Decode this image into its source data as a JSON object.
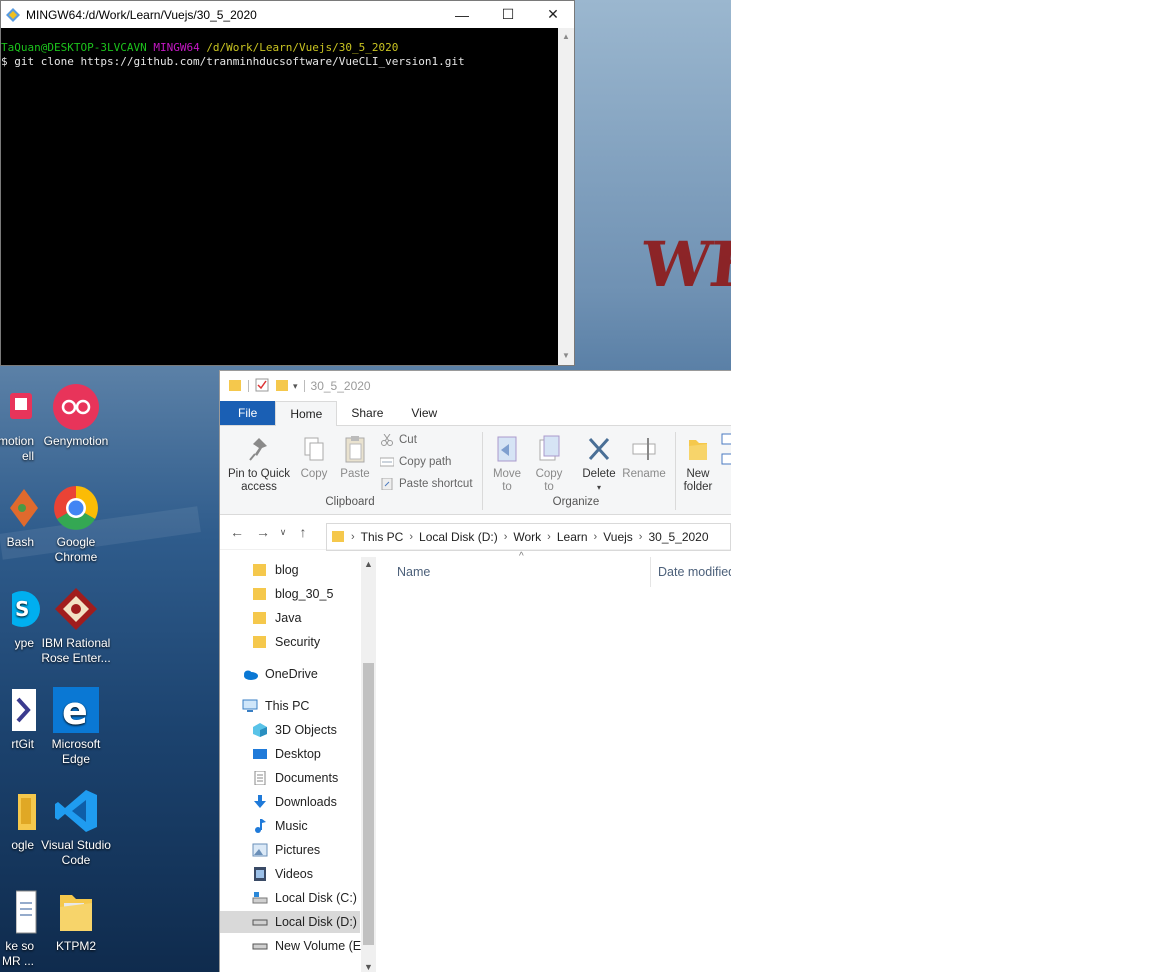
{
  "terminal": {
    "title": "MINGW64:/d/Work/Learn/Vuejs/30_5_2020",
    "prompt_user": "TaQuan@DESKTOP-3LVCAVN",
    "prompt_shell": "MINGW64",
    "prompt_path": "/d/Work/Learn/Vuejs/30_5_2020",
    "command": "$ git clone https://github.com/tranminhducsoftware/VueCLI_version1.git",
    "minimize": "—",
    "maximize": "☐",
    "close": "✕"
  },
  "wallpaper": {
    "text": "WHY"
  },
  "desktop_icons": [
    {
      "label": "motion\nell",
      "icon": "genymotion-shell-icon"
    },
    {
      "label": "Genymotion",
      "icon": "genymotion-icon"
    },
    {
      "label": "Bash",
      "icon": "git-bash-icon"
    },
    {
      "label": "Google\nChrome",
      "icon": "chrome-icon"
    },
    {
      "label": "ype",
      "icon": "skype-icon"
    },
    {
      "label": "IBM Rational\nRose Enter...",
      "icon": "ibm-rational-rose-icon"
    },
    {
      "label": "rtGit",
      "icon": "smartgit-icon"
    },
    {
      "label": "Microsoft\nEdge",
      "icon": "edge-icon"
    },
    {
      "label": "ogle",
      "icon": "folder-icon"
    },
    {
      "label": "Visual Studio\nCode",
      "icon": "vscode-icon"
    },
    {
      "label": "ke so\nMR ...",
      "icon": "document-icon"
    },
    {
      "label": "KTPM2",
      "icon": "folder-icon"
    }
  ],
  "explorer": {
    "qat_title": "30_5_2020",
    "tabs": [
      "File",
      "Home",
      "Share",
      "View"
    ],
    "ribbon": {
      "pin": "Pin to Quick\naccess",
      "copy": "Copy",
      "paste": "Paste",
      "cut": "Cut",
      "copy_path": "Copy path",
      "paste_shortcut": "Paste shortcut",
      "clipboard": "Clipboard",
      "move_to": "Move\nto",
      "copy_to": "Copy\nto",
      "delete": "Delete",
      "rename": "Rename",
      "organize": "Organize",
      "new_folder": "New\nfolder"
    },
    "breadcrumb": [
      "This PC",
      "Local Disk (D:)",
      "Work",
      "Learn",
      "Vuejs",
      "30_5_2020"
    ],
    "nav_items": [
      {
        "label": "blog",
        "icon": "folder-icon"
      },
      {
        "label": "blog_30_5",
        "icon": "folder-icon"
      },
      {
        "label": "Java",
        "icon": "folder-icon"
      },
      {
        "label": "Security",
        "icon": "folder-icon"
      },
      {
        "label": "OneDrive",
        "icon": "onedrive-icon"
      },
      {
        "label": "This PC",
        "icon": "this-pc-icon"
      },
      {
        "label": "3D Objects",
        "icon": "3d-objects-icon"
      },
      {
        "label": "Desktop",
        "icon": "desktop-icon"
      },
      {
        "label": "Documents",
        "icon": "documents-icon"
      },
      {
        "label": "Downloads",
        "icon": "downloads-icon"
      },
      {
        "label": "Music",
        "icon": "music-icon"
      },
      {
        "label": "Pictures",
        "icon": "pictures-icon"
      },
      {
        "label": "Videos",
        "icon": "videos-icon"
      },
      {
        "label": "Local Disk (C:)",
        "icon": "drive-icon"
      },
      {
        "label": "Local Disk (D:)",
        "icon": "drive-icon"
      },
      {
        "label": "New Volume (E:)",
        "icon": "drive-icon"
      }
    ],
    "columns": [
      "Name",
      "Date modified"
    ]
  }
}
